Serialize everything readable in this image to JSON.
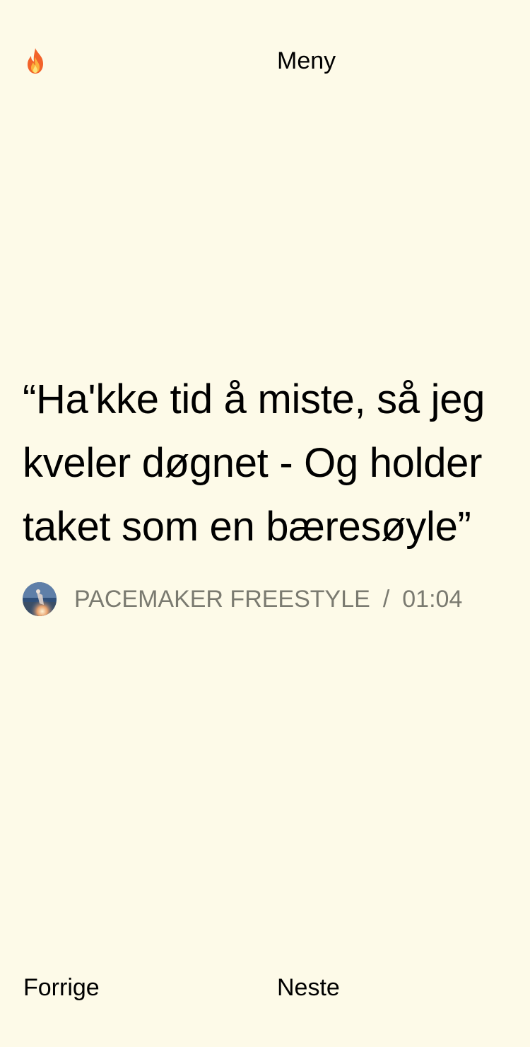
{
  "header": {
    "logo_icon": "fire-emoji-icon",
    "menu_label": "Meny"
  },
  "quote": {
    "text": "“Ha'kke tid å miste, så jeg kveler døgnet - Og holder taket som en bæresøyle”"
  },
  "meta": {
    "avatar_icon": "album-cover-avatar",
    "song_title": "PACEMAKER FREESTYLE",
    "separator": "/",
    "timestamp": "01:04"
  },
  "footer": {
    "prev_label": "Forrige",
    "next_label": "Neste"
  },
  "colors": {
    "background": "#fdfae8",
    "text": "#000000",
    "meta_text": "#7a7a70"
  }
}
